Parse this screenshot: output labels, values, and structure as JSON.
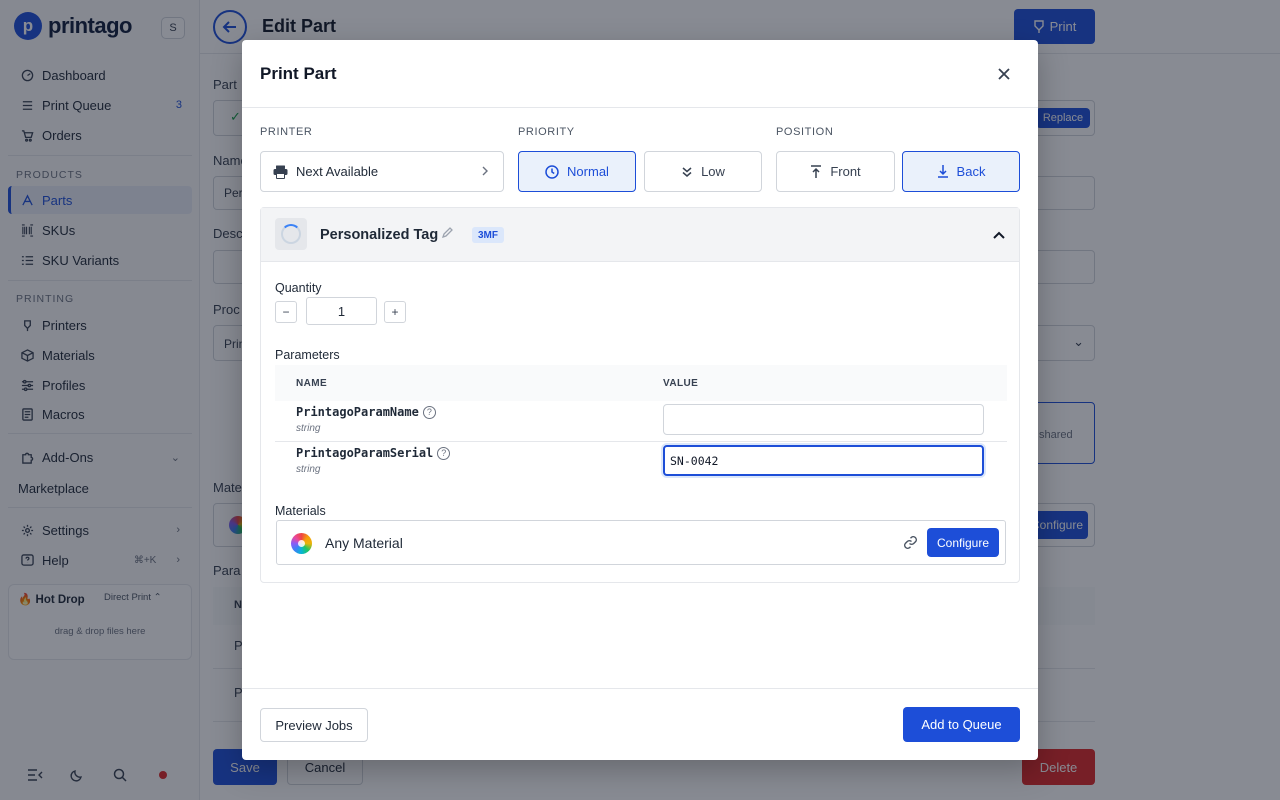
{
  "sidebar": {
    "logo_mark": "p",
    "logo_text": "printago",
    "workspace_badge": "S",
    "nav": {
      "dashboard": "Dashboard",
      "print_queue": "Print Queue",
      "print_queue_count": "3",
      "orders": "Orders",
      "products_section": "PRODUCTS",
      "parts": "Parts",
      "skus": "SKUs",
      "sku_variants": "SKU Variants",
      "printing_section": "PRINTING",
      "printers": "Printers",
      "materials": "Materials",
      "profiles": "Profiles",
      "macros": "Macros",
      "addons": "Add-Ons",
      "marketplace": "Marketplace",
      "settings": "Settings",
      "help": "Help",
      "help_shortcut": "⌘+K"
    },
    "hotdrop": {
      "title": "🔥 Hot Drop",
      "mode": "Direct Print",
      "hint": "drag & drop files here"
    }
  },
  "page": {
    "title": "Edit Part",
    "print_label": "Print",
    "bg_labels": {
      "part": "Part",
      "name": "Name",
      "name_value": "Pers",
      "description": "Desc",
      "process": "Proc",
      "process_value": "Prin",
      "materials": "Mate",
      "params": "Para",
      "table_n": "N",
      "row1": "P",
      "row2": "P",
      "replace": "Replace",
      "shared": "shared",
      "configure": "Configure"
    },
    "save_label": "Save",
    "cancel_label": "Cancel",
    "delete_label": "Delete"
  },
  "modal": {
    "title": "Print Part",
    "printer": {
      "label": "PRINTER",
      "value": "Next Available"
    },
    "priority": {
      "label": "PRIORITY",
      "options": [
        "Normal",
        "Low"
      ],
      "selected": "Normal"
    },
    "position": {
      "label": "POSITION",
      "options": [
        "Front",
        "Back"
      ],
      "selected": "Back"
    },
    "part": {
      "name": "Personalized Tag",
      "format_tag": "3MF",
      "quantity_label": "Quantity",
      "quantity_value": "1",
      "minus": "−",
      "plus": "+",
      "parameters_label": "Parameters",
      "table_headers": {
        "name": "NAME",
        "value": "VALUE"
      },
      "parameters": [
        {
          "name": "PrintagoParamName",
          "type": "string",
          "value": ""
        },
        {
          "name": "PrintagoParamSerial",
          "type": "string",
          "value": "SN-0042"
        }
      ],
      "materials_label": "Materials",
      "material_name": "Any Material",
      "configure_label": "Configure"
    },
    "preview_label": "Preview Jobs",
    "add_label": "Add to Queue"
  },
  "colors": {
    "accent": "#1d4ed8",
    "danger": "#dc2626",
    "selected_bg": "#eaf1fb"
  }
}
